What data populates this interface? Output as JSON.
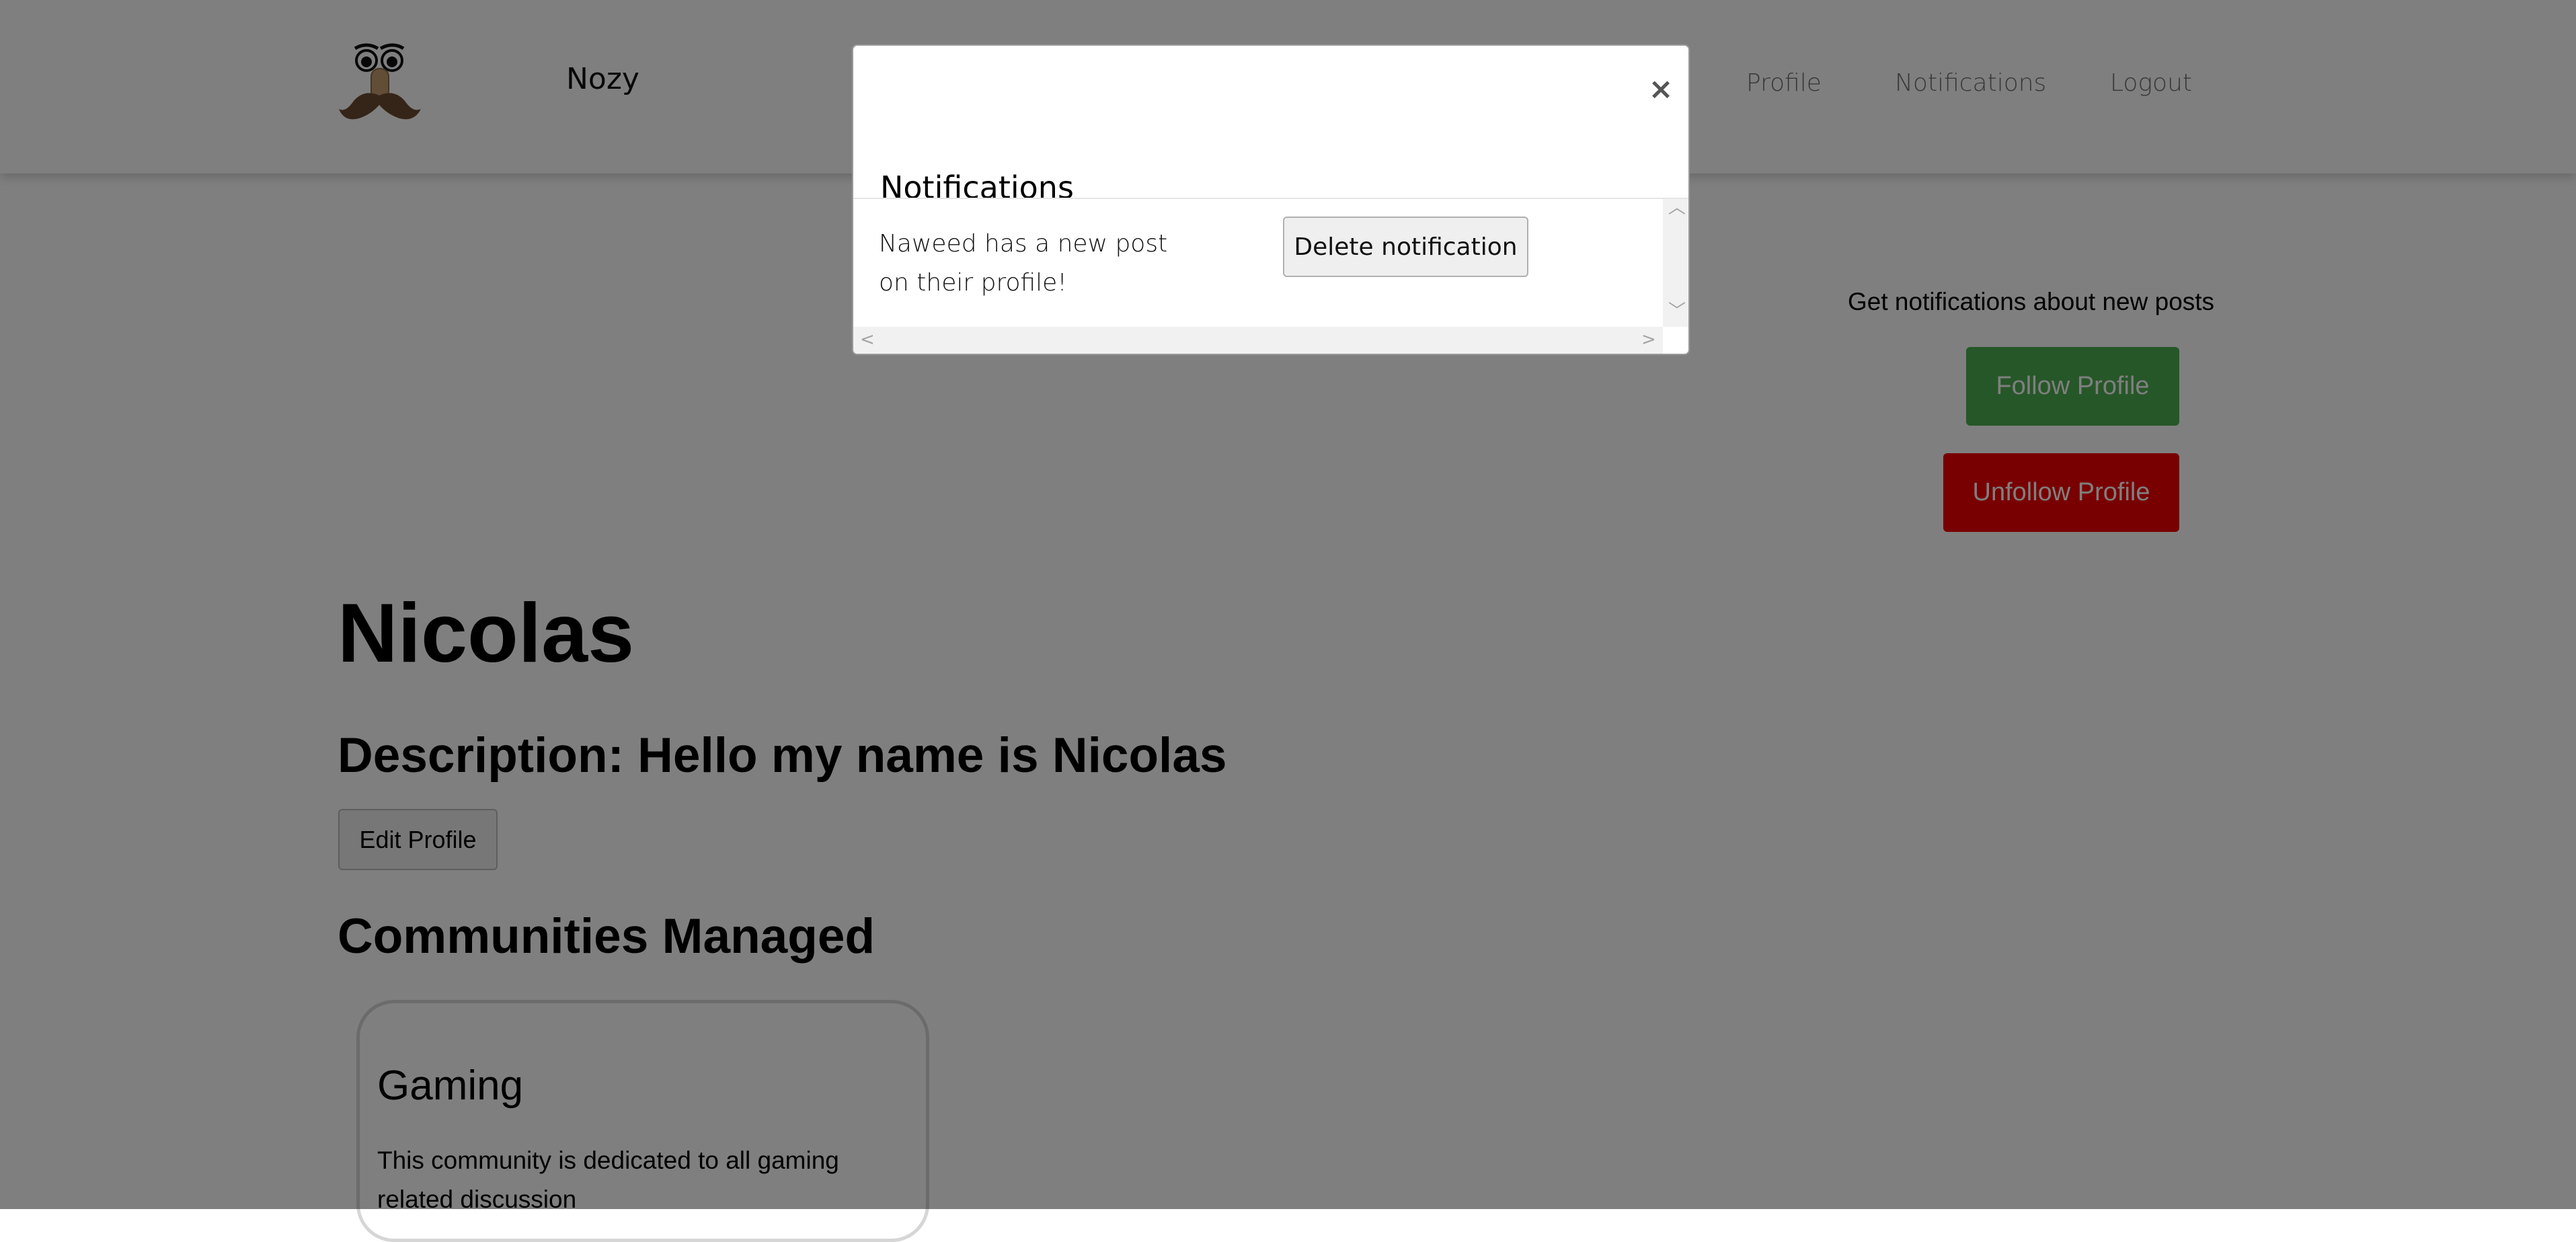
{
  "colors": {
    "follow_button": "#4caf50",
    "unfollow_button": "#f00000",
    "backdrop": "rgba(0,0,0,0.5)"
  },
  "navbar": {
    "brand": "Nozy",
    "logo_icon": "mustache-face-logo",
    "links": {
      "profile": "Profile",
      "notifications": "Notifications",
      "logout": "Logout"
    }
  },
  "follow": {
    "prompt": "Get notifications about new posts",
    "follow_label": "Follow Profile",
    "unfollow_label": "Unfollow Profile"
  },
  "profile": {
    "name": "Nicolas",
    "description": "Description: Hello my name is Nicolas",
    "edit_label": "Edit Profile"
  },
  "communities": {
    "heading": "Communities Managed",
    "items": [
      {
        "title": "Gaming",
        "description": "This community is dedicated to all gaming related discussion"
      }
    ]
  },
  "modal": {
    "title": "Notifications",
    "close_label": "×",
    "notifications": [
      {
        "text": "Naweed has a new post on their profile!",
        "delete_label": "Delete notification"
      }
    ]
  }
}
